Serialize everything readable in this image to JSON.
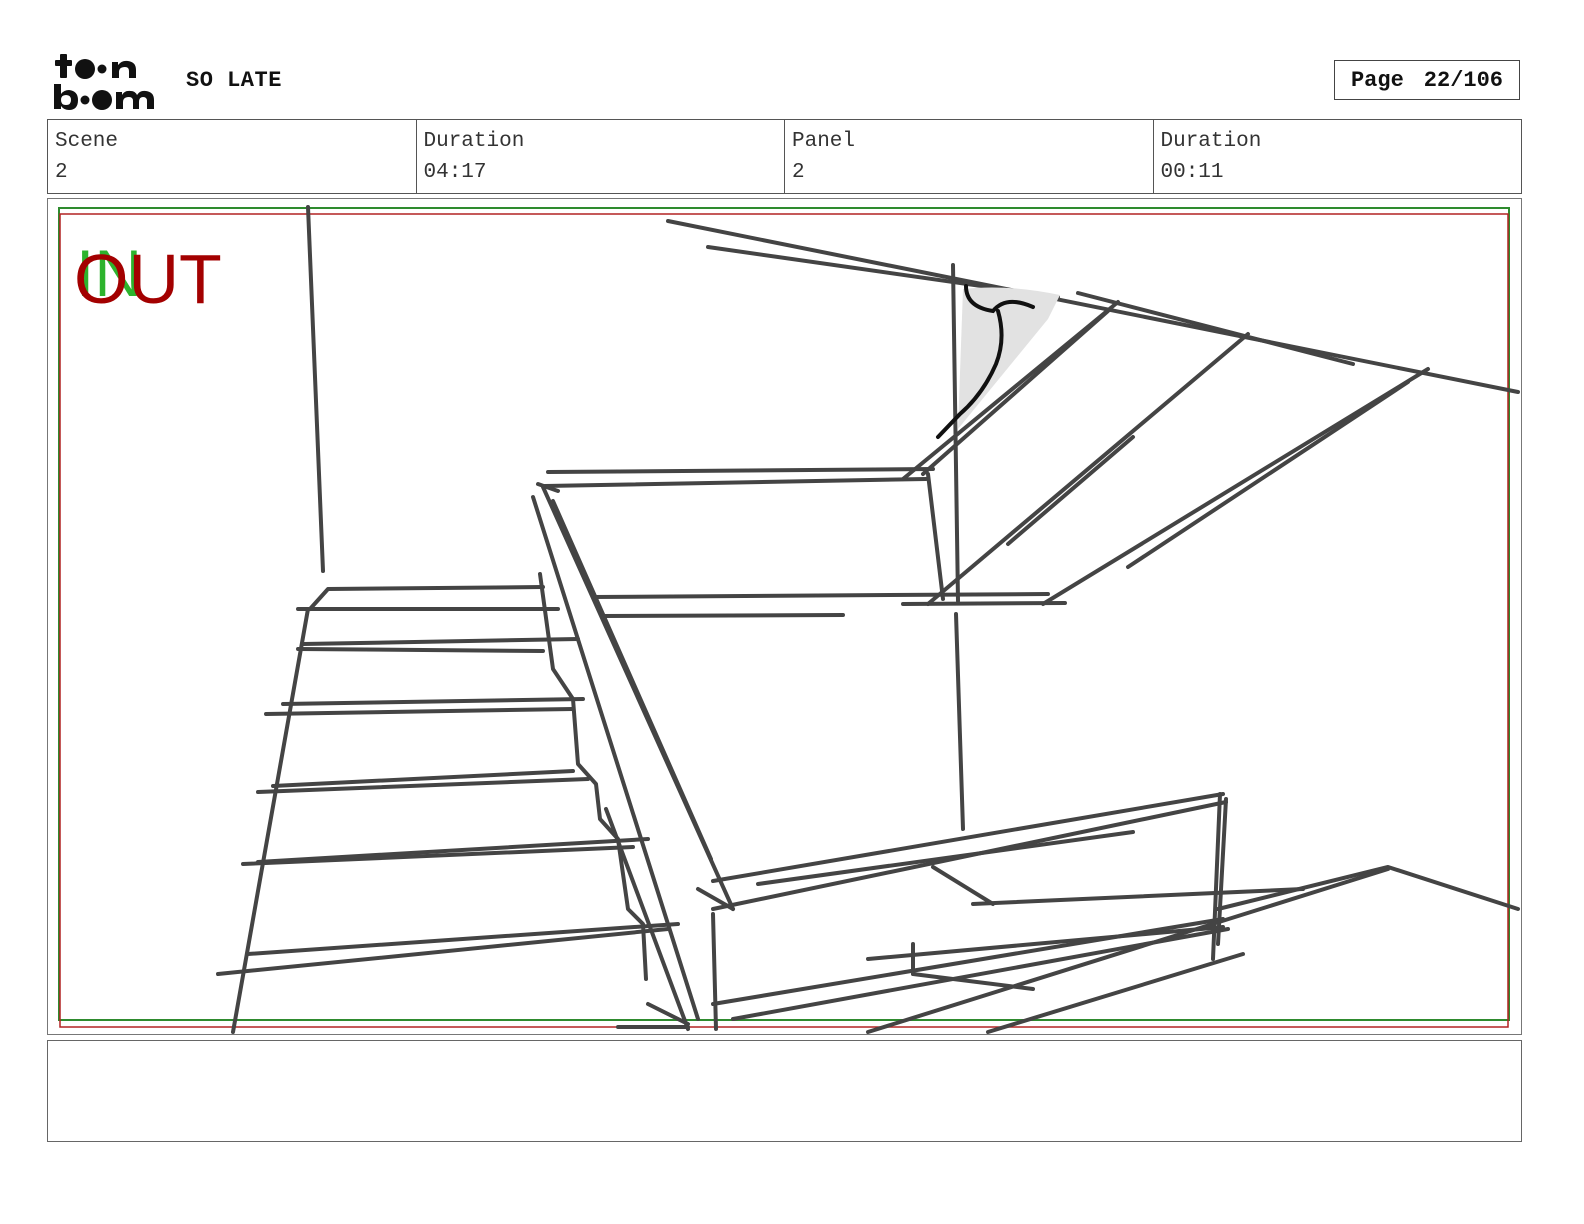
{
  "header": {
    "logo_text": "toonboom",
    "project_title": "SO LATE",
    "page_label": "Page",
    "page_value": "22/106"
  },
  "info": {
    "scene_label": "Scene",
    "scene_value": "2",
    "scene_duration_label": "Duration",
    "scene_duration_value": "04:17",
    "panel_label": "Panel",
    "panel_value": "2",
    "panel_duration_label": "Duration",
    "panel_duration_value": "00:11"
  },
  "panel_markers": {
    "in_label": "IN",
    "out_label": "OUT",
    "in_color": "#2db32d",
    "out_color": "#a30000"
  },
  "caption": {
    "text": ""
  }
}
